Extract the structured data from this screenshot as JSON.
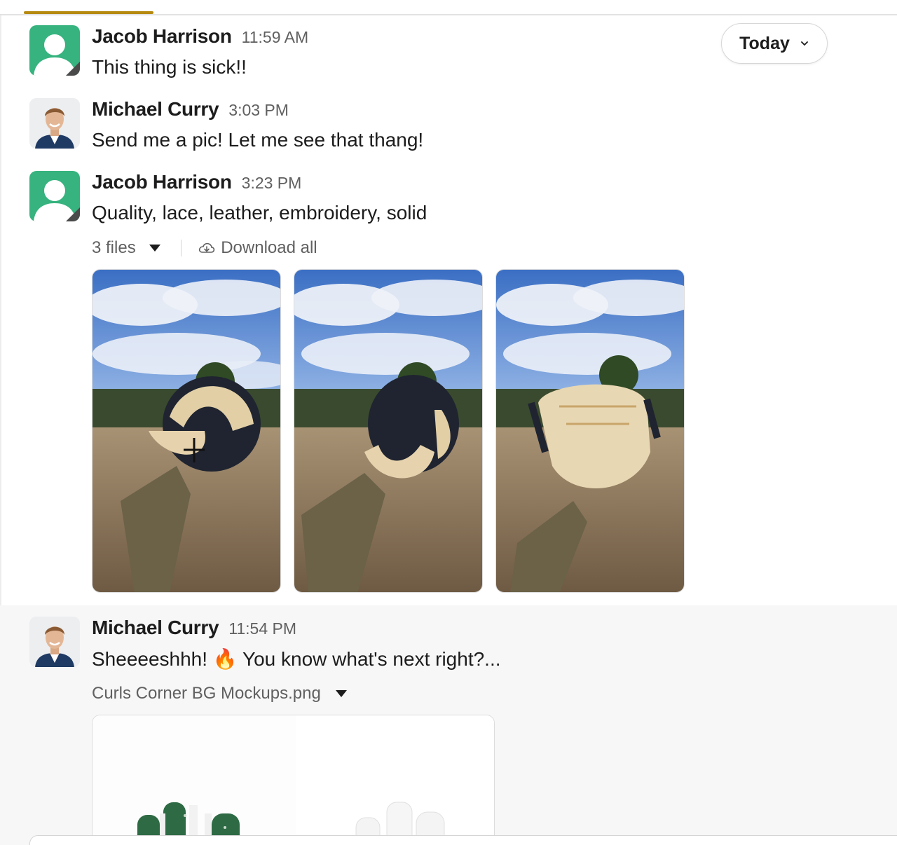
{
  "date_pill": {
    "label": "Today"
  },
  "messages": [
    {
      "name": "Jacob Harrison",
      "time": "11:59 AM",
      "text": "This thing is sick!!"
    },
    {
      "name": "Michael Curry",
      "time": "3:03 PM",
      "text": "Send me a pic! Let me see that thang!"
    },
    {
      "name": "Jacob Harrison",
      "time": "3:23 PM",
      "text": "Quality, lace, leather, embroidery, solid",
      "files_label": "3 files",
      "download_label": "Download all"
    },
    {
      "name": "Michael Curry",
      "time": "11:54 PM",
      "text_before": "Sheeeeshhh!",
      "emoji": "🔥",
      "text_after": "You know what's next right?...",
      "file_name": "Curls Corner BG Mockups.png"
    }
  ],
  "colors": {
    "accent": "#b58a0f",
    "avatar_green": "#36b37e",
    "batting_glove_green": "#2e6b45"
  }
}
